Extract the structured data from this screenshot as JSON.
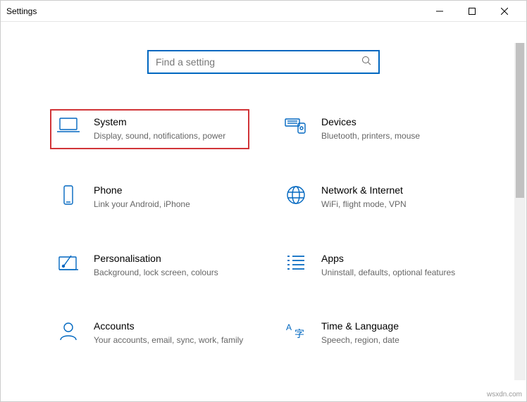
{
  "window": {
    "title": "Settings"
  },
  "search": {
    "placeholder": "Find a setting"
  },
  "tiles": {
    "system": {
      "title": "System",
      "sub": "Display, sound, notifications, power"
    },
    "devices": {
      "title": "Devices",
      "sub": "Bluetooth, printers, mouse"
    },
    "phone": {
      "title": "Phone",
      "sub": "Link your Android, iPhone"
    },
    "network": {
      "title": "Network & Internet",
      "sub": "WiFi, flight mode, VPN"
    },
    "personalisation": {
      "title": "Personalisation",
      "sub": "Background, lock screen, colours"
    },
    "apps": {
      "title": "Apps",
      "sub": "Uninstall, defaults, optional features"
    },
    "accounts": {
      "title": "Accounts",
      "sub": "Your accounts, email, sync, work, family"
    },
    "timelang": {
      "title": "Time & Language",
      "sub": "Speech, region, date"
    }
  },
  "watermark": "wsxdn.com"
}
